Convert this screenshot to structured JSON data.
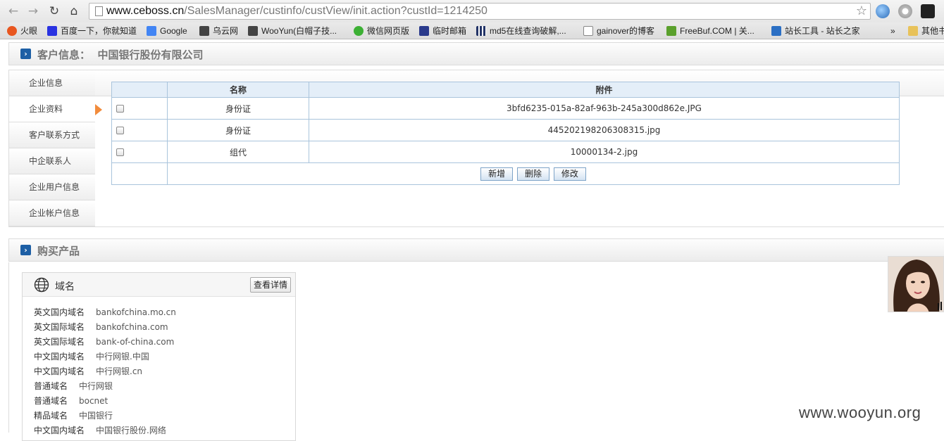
{
  "browser": {
    "url_host": "www.ceboss.cn",
    "url_path": "/SalesManager/custinfo/custView/init.action?custId=1214250",
    "bookmarks": [
      {
        "label": "火眼",
        "color": "#e8561f"
      },
      {
        "label": "百度一下，你就知道",
        "color": "#2932e1"
      },
      {
        "label": "Google",
        "color": "#4285f4"
      },
      {
        "label": "乌云网",
        "color": "#444444"
      },
      {
        "label": "WooYun(白帽子技...",
        "color": "#444444"
      },
      {
        "label": "微信网页版",
        "color": "#3cb034"
      },
      {
        "label": "临时邮箱",
        "color": "#2a3a8c"
      },
      {
        "label": "md5在线查询破解,...",
        "color": "#223366"
      },
      {
        "label": "gainover的博客",
        "color": "#ffffff"
      },
      {
        "label": "FreeBuf.COM | 关...",
        "color": "#5aa02c"
      },
      {
        "label": "站长工具 - 站长之家",
        "color": "#2b6fc4"
      },
      {
        "label": "»",
        "color": ""
      },
      {
        "label": "其他书",
        "color": "#e8c25a"
      }
    ]
  },
  "customer": {
    "label": "客户信息：",
    "name": "中国银行股份有限公司"
  },
  "tabs": [
    "企业信息",
    "企业资料",
    "客户联系方式",
    "中企联系人",
    "企业用户信息",
    "企业帐户信息"
  ],
  "attachments": {
    "headers": {
      "name": "名称",
      "file": "附件"
    },
    "rows": [
      {
        "name": "身份证",
        "file": "3bfd6235-015a-82af-963b-245a300d862e.JPG"
      },
      {
        "name": "身份证",
        "file": "445202198206308315.jpg"
      },
      {
        "name": "组代",
        "file": "10000134-2.jpg"
      }
    ],
    "buttons": {
      "add": "新增",
      "delete": "删除",
      "edit": "修改"
    }
  },
  "products": {
    "title": "购买产品",
    "card_title": "域名",
    "detail_button": "查看详情",
    "domains": [
      {
        "type": "英文国内域名",
        "value": "bankofchina.mo.cn"
      },
      {
        "type": "英文国际域名",
        "value": "bankofchina.com"
      },
      {
        "type": "英文国际域名",
        "value": "bank-of-china.com"
      },
      {
        "type": "中文国内域名",
        "value": "中行网银.中国"
      },
      {
        "type": "中文国内域名",
        "value": "中行网银.cn"
      },
      {
        "type": "普通域名",
        "value": "中行网银"
      },
      {
        "type": "普通域名",
        "value": "bocnet"
      },
      {
        "type": "精品域名",
        "value": "中国银行"
      },
      {
        "type": "中文国内域名",
        "value": "中国银行股份.网络"
      }
    ]
  },
  "watermark": "www.wooyun.org"
}
